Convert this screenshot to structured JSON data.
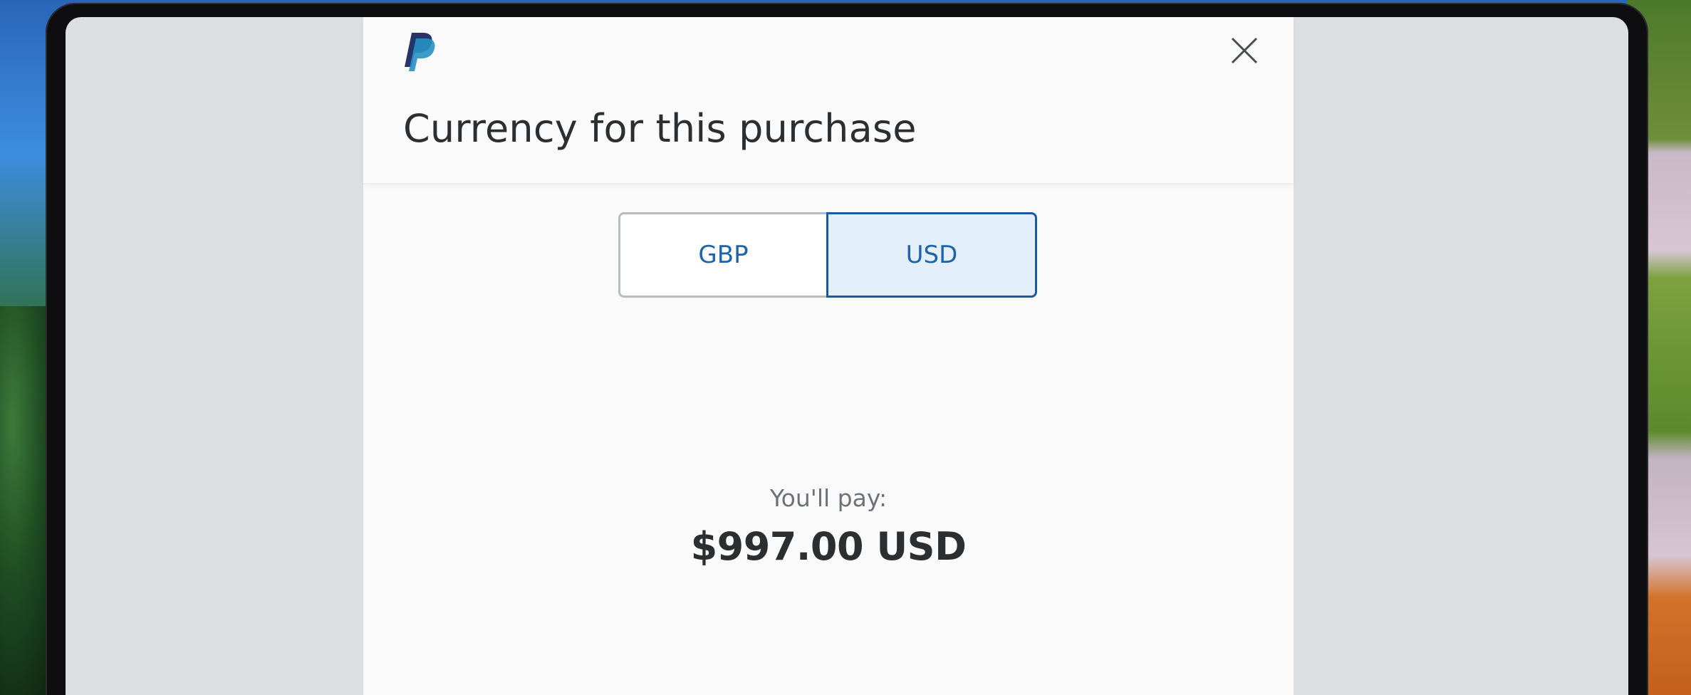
{
  "modal": {
    "title": "Currency for this purchase",
    "logo_icon": "paypal-logo-icon",
    "close_icon": "close-icon"
  },
  "currency_toggle": {
    "options": [
      {
        "label": "GBP",
        "selected": false
      },
      {
        "label": "USD",
        "selected": true
      }
    ]
  },
  "summary": {
    "label": "You'll pay:",
    "amount": "$997.00 USD"
  },
  "colors": {
    "accent": "#1b5aa0",
    "selected_bg": "#e3f0fb",
    "text_dark": "#2c2e2f",
    "text_muted": "#6c7378"
  }
}
